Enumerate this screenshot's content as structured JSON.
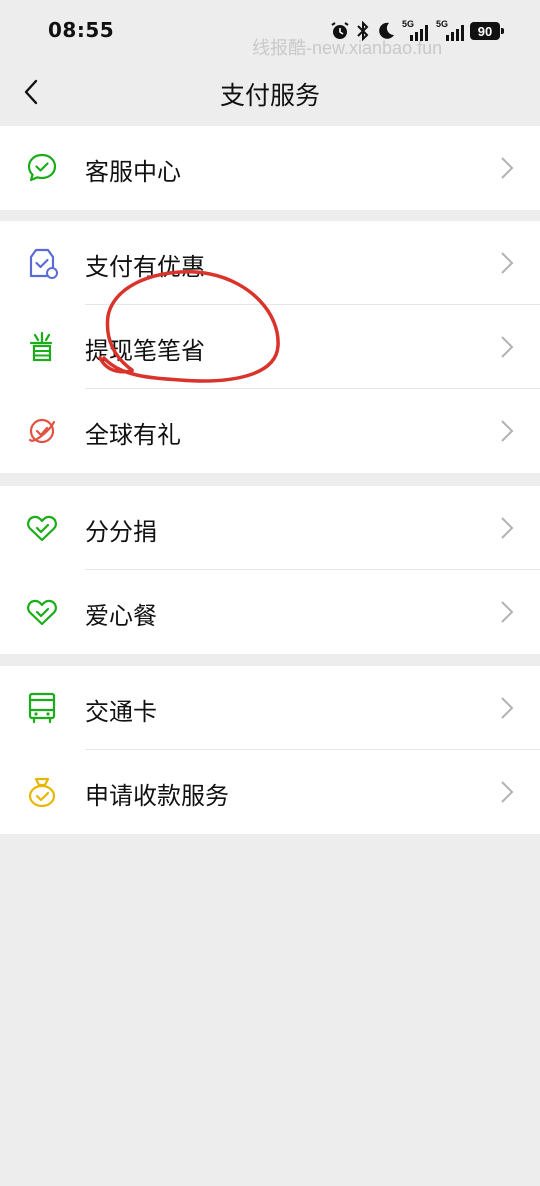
{
  "status_bar": {
    "time": "08:55",
    "watermark": "线报酷-new.xianbao.fun",
    "battery": "90",
    "icons": [
      "alarm-icon",
      "bluetooth-icon",
      "moon-icon",
      "signal-5g-icon",
      "signal-5g-icon-2",
      "battery-icon"
    ],
    "signal_label_1": "5G",
    "signal_label_2": "5G"
  },
  "nav": {
    "title": "支付服务",
    "back_icon": "chevron-left-icon"
  },
  "groups": [
    {
      "items": [
        {
          "label": "客服中心",
          "icon": "chat-check-icon",
          "color": "#1aad19"
        }
      ]
    },
    {
      "items": [
        {
          "label": "支付有优惠",
          "icon": "coupon-icon",
          "color": "#5b6ad6"
        },
        {
          "label": "提现笔笔省",
          "icon": "save-icon",
          "color": "#1aad19"
        },
        {
          "label": "全球有礼",
          "icon": "globe-check-icon",
          "color": "#e15241"
        }
      ]
    },
    {
      "items": [
        {
          "label": "分分捐",
          "icon": "heart-check-icon",
          "color": "#1aad19"
        },
        {
          "label": "爱心餐",
          "icon": "heart-check-icon-2",
          "color": "#1aad19"
        }
      ]
    },
    {
      "items": [
        {
          "label": "交通卡",
          "icon": "bus-icon",
          "color": "#1aad19"
        },
        {
          "label": "申请收款服务",
          "icon": "money-bag-icon",
          "color": "#e8b600"
        }
      ]
    }
  ],
  "colors": {
    "background": "#ededed",
    "annotation": "#d9342b",
    "chevron": "#b2b2b2"
  }
}
